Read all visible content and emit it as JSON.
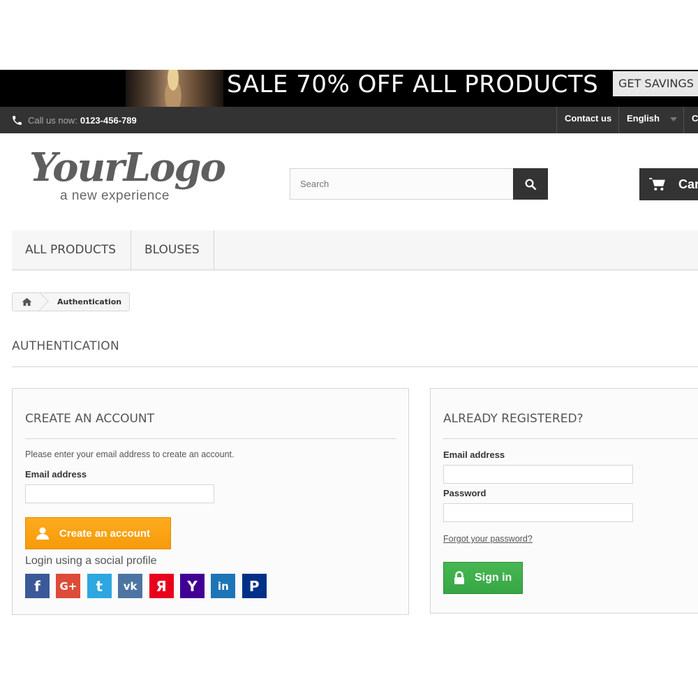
{
  "banner": {
    "title": "SALE 70% OFF ALL PRODUCTS",
    "cta": "GET SAVINGS N"
  },
  "topbar": {
    "call_label": "Call us now:",
    "phone": "0123-456-789",
    "contact": "Contact us",
    "language": "English",
    "currency_partial": "C"
  },
  "header": {
    "logo_script": "YourLogo",
    "logo_tagline": "a new experience",
    "search_placeholder": "Search",
    "cart_label": "Car"
  },
  "nav": {
    "items": [
      "ALL PRODUCTS",
      "BLOUSES"
    ]
  },
  "breadcrumb": {
    "current": "Authentication"
  },
  "page": {
    "title": "AUTHENTICATION"
  },
  "create_account": {
    "title": "CREATE AN ACCOUNT",
    "hint": "Please enter your email address to create an account.",
    "email_label": "Email address",
    "email_value": "",
    "button": "Create an account",
    "social_label": "Login using a social profile",
    "socials": [
      {
        "name": "facebook",
        "glyph": "f",
        "color": "#3b5998"
      },
      {
        "name": "google-plus",
        "glyph": "G+",
        "color": "#dd4b39"
      },
      {
        "name": "twitter",
        "glyph": "t",
        "color": "#2ca7e0"
      },
      {
        "name": "vk",
        "glyph": "vk",
        "color": "#4c75a3"
      },
      {
        "name": "yandex",
        "glyph": "Я",
        "color": "#e8001c"
      },
      {
        "name": "yahoo",
        "glyph": "Y",
        "color": "#410093"
      },
      {
        "name": "linkedin",
        "glyph": "in",
        "color": "#1d75b6"
      },
      {
        "name": "paypal",
        "glyph": "P",
        "color": "#003087"
      }
    ]
  },
  "registered": {
    "title": "ALREADY REGISTERED?",
    "email_label": "Email address",
    "email_value": "",
    "password_label": "Password",
    "password_value": "",
    "forgot": "Forgot your password?",
    "button": "Sign in"
  }
}
